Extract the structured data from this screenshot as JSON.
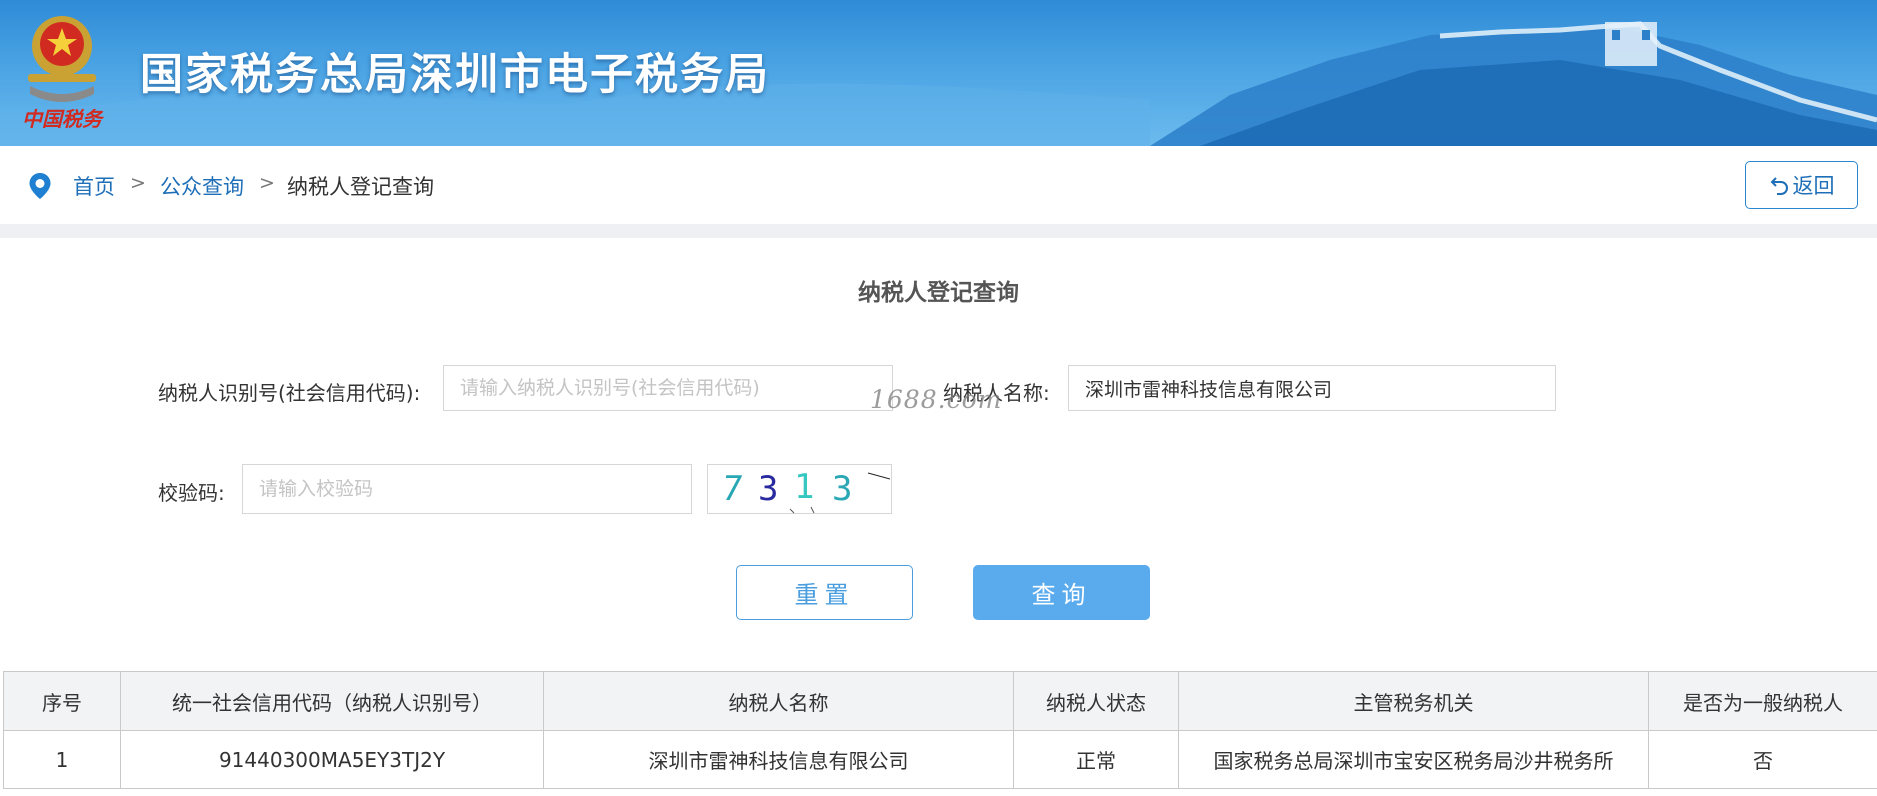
{
  "header": {
    "title": "国家税务总局深圳市电子税务局",
    "emblem_text": "中国税务"
  },
  "breadcrumb": {
    "items": [
      "首页",
      "公众查询",
      "纳税人登记查询"
    ],
    "separator": ">"
  },
  "back_button": {
    "label": "返回",
    "icon": "undo-arrow-icon"
  },
  "form": {
    "title": "纳税人登记查询",
    "taxpayer_id_label": "纳税人识别号(社会信用代码):",
    "taxpayer_id_placeholder": "请输入纳税人识别号(社会信用代码)",
    "taxpayer_id_value": "",
    "taxpayer_name_label": "纳税人名称:",
    "taxpayer_name_value": "深圳市雷神科技信息有限公司",
    "captcha_label": "校验码:",
    "captcha_placeholder": "请输入校验码",
    "captcha_value": "",
    "captcha_text": [
      "7",
      "3",
      "1",
      "3"
    ],
    "reset_label": "重置",
    "query_label": "查询"
  },
  "watermark": "1688.com",
  "table": {
    "columns": [
      "序号",
      "统一社会信用代码（纳税人识别号）",
      "纳税人名称",
      "纳税人状态",
      "主管税务机关",
      "是否为一般纳税人"
    ],
    "rows": [
      [
        "1",
        "91440300MA5EY3TJ2Y",
        "深圳市雷神科技信息有限公司",
        "正常",
        "国家税务总局深圳市宝安区税务局沙井税务所",
        "否"
      ]
    ]
  },
  "colors": {
    "accent": "#1f6fb8",
    "primary_button": "#5aabee",
    "banner": "#3d98dd"
  }
}
